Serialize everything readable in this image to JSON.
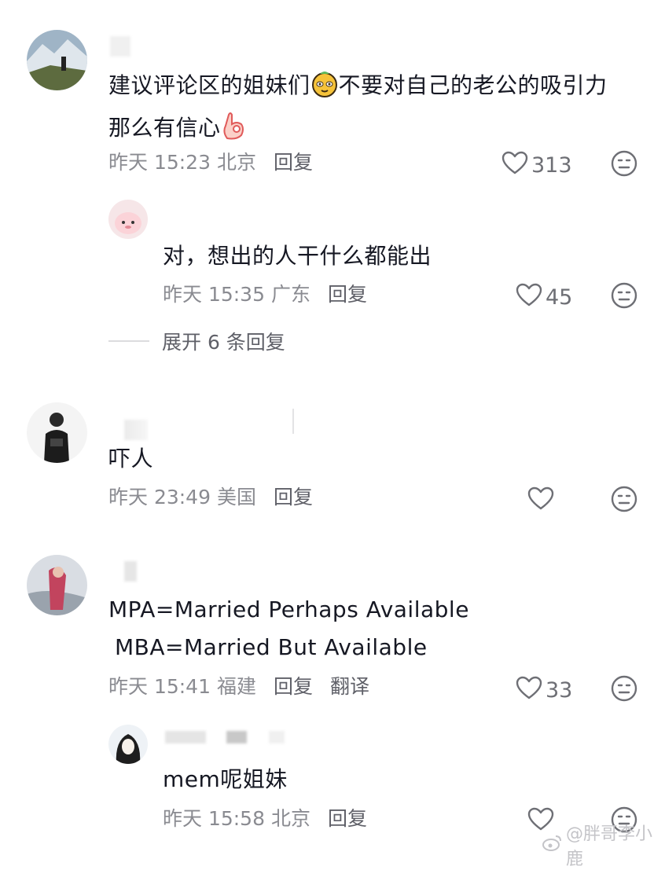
{
  "comments": [
    {
      "id": "c1",
      "text_line1": "建议评论区的姐妹们",
      "emoji1": "[yellow-face-emoji]",
      "text_line1b": "不要对自己的老公的吸引力",
      "text_line2": "那么有信心",
      "emoji2": "[ok-hand-emoji]",
      "time": "昨天 15:23 北京",
      "reply": "回复",
      "likes": "313",
      "replies": [
        {
          "text": "对，想出的人干什么都能出",
          "time": "昨天 15:35 广东",
          "reply": "回复",
          "likes": "45"
        }
      ],
      "expand": "展开 6 条回复"
    },
    {
      "id": "c2",
      "text": "吓人",
      "time": "昨天 23:49 美国",
      "reply": "回复",
      "likes": ""
    },
    {
      "id": "c3",
      "text_line1": "MPA=Married Perhaps Available",
      "text_line2": "MBA=Married But Available",
      "time": "昨天 15:41 福建",
      "reply": "回复",
      "translate": "翻译",
      "likes": "33",
      "replies": [
        {
          "text": "mem呢姐妹",
          "time": "昨天 15:58 北京",
          "reply": "回复",
          "likes": ""
        }
      ]
    }
  ],
  "watermark": "@胖哥李小鹿",
  "colors": {
    "text": "#161823",
    "meta": "#8a8b91",
    "icon": "#6e6f75"
  }
}
